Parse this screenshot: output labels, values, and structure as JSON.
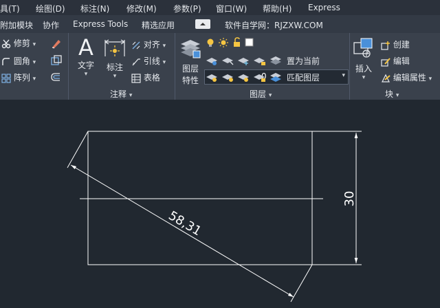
{
  "menu": {
    "items": [
      "具(T)",
      "绘图(D)",
      "标注(N)",
      "修改(M)",
      "参数(P)",
      "窗口(W)",
      "帮助(H)",
      "Express"
    ]
  },
  "tabs": {
    "items": [
      "附加模块",
      "协作",
      "Express Tools",
      "精选应用"
    ],
    "site_text": "软件自学网：RJZXW.COM"
  },
  "ribbon": {
    "modify": {
      "trim": "修剪",
      "fillet": "圆角",
      "array": "阵列"
    },
    "annotation": {
      "text": "文字",
      "dimension": "标注",
      "align": "对齐",
      "leader": "引线",
      "table": "表格",
      "title": "注释"
    },
    "layers": {
      "current_layer": "0",
      "properties_line1": "图层",
      "properties_line2": "特性",
      "set_current": "置为当前",
      "match_layer": "匹配图层",
      "title": "图层"
    },
    "block": {
      "insert": "插入",
      "create": "创建",
      "edit": "编辑",
      "edit_attributes": "编辑属性",
      "title": "块"
    }
  },
  "drawing": {
    "dim_vertical": "30",
    "dim_aligned": "58,31"
  },
  "colors": {
    "canvas": "#212830",
    "line": "#ffffff",
    "ribbon": "#3a414c"
  }
}
